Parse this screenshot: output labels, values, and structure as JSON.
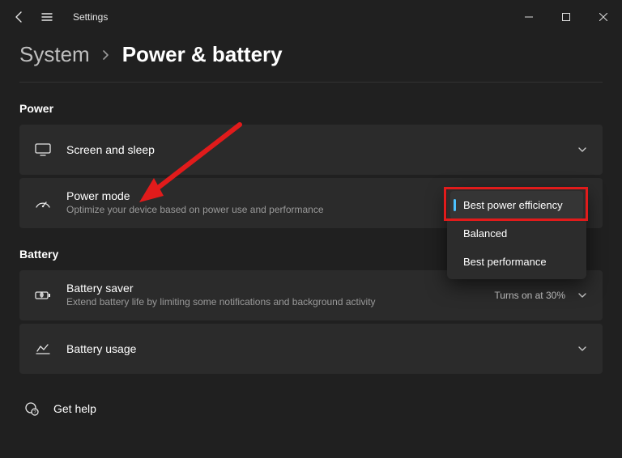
{
  "titlebar": {
    "title": "Settings"
  },
  "breadcrumb": {
    "parent": "System",
    "page": "Power & battery"
  },
  "sections": {
    "power": {
      "title": "Power",
      "screen_sleep": {
        "label": "Screen and sleep"
      },
      "power_mode": {
        "label": "Power mode",
        "sub": "Optimize your device based on power use and performance",
        "options": {
          "opt1": "Best power efficiency",
          "opt2": "Balanced",
          "opt3": "Best performance"
        }
      }
    },
    "battery": {
      "title": "Battery",
      "saver": {
        "label": "Battery saver",
        "sub": "Extend battery life by limiting some notifications and background activity",
        "value": "Turns on at 30%"
      },
      "usage": {
        "label": "Battery usage"
      }
    }
  },
  "help": {
    "label": "Get help"
  },
  "colors": {
    "accent": "#4cc2ff",
    "highlight": "#e11b1b"
  }
}
